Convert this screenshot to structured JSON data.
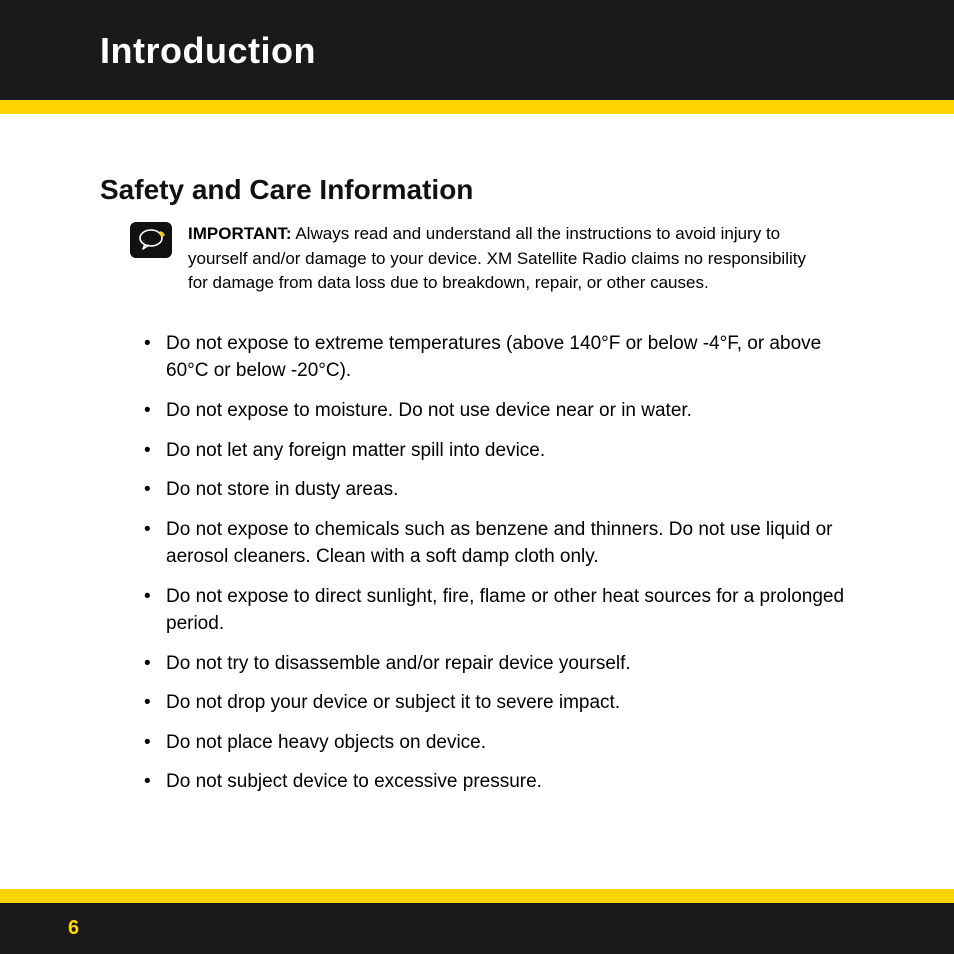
{
  "header": {
    "title": "Introduction"
  },
  "section": {
    "heading": "Safety and Care Information"
  },
  "notice": {
    "label": "IMPORTANT:",
    "text": " Always read and understand all the instructions to avoid injury to yourself and/or damage to your device. XM Satellite Radio claims no responsibility for damage from data loss due to breakdown, repair, or other causes."
  },
  "bullets": [
    "Do not expose to extreme temperatures (above 140°F or below -4°F, or above 60°C or below -20°C).",
    "Do not expose to moisture. Do not use device near or in water.",
    "Do not let any foreign matter spill into device.",
    "Do not store in dusty areas.",
    "Do not expose to chemicals such as benzene and thinners. Do not use liquid or aerosol cleaners. Clean with a soft damp cloth only.",
    "Do not expose to direct sunlight, fire, flame or other heat sources for a prolonged period.",
    "Do not try to disassemble and/or repair device yourself.",
    "Do not drop your device or subject it to severe impact.",
    "Do not place heavy objects on device.",
    "Do not subject device to excessive pressure."
  ],
  "footer": {
    "page": "6"
  },
  "colors": {
    "accent": "#ffd400",
    "dark": "#1a1a1a"
  }
}
